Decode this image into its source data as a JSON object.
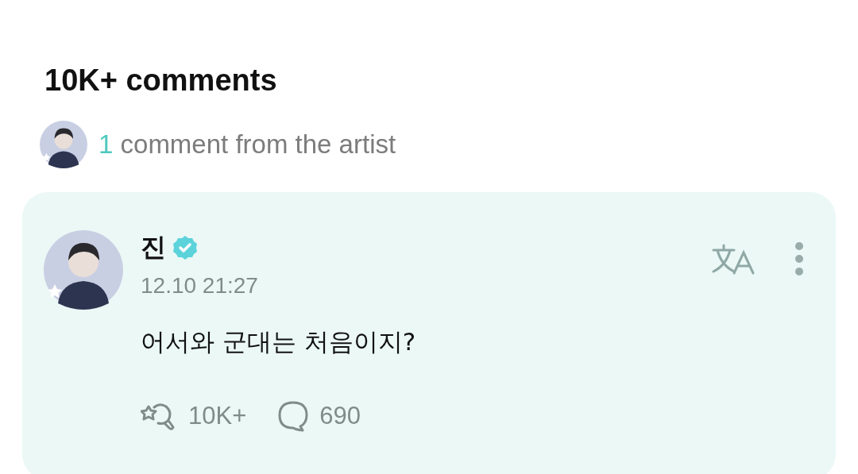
{
  "heading": "10K+ comments",
  "artist_summary": {
    "count": "1",
    "label": "comment from the artist"
  },
  "comment": {
    "author": "진",
    "verified": true,
    "time": "12.10 21:27",
    "text": "어서와 군대는 처음이지?",
    "reactions": "10K+",
    "replies": "690"
  }
}
